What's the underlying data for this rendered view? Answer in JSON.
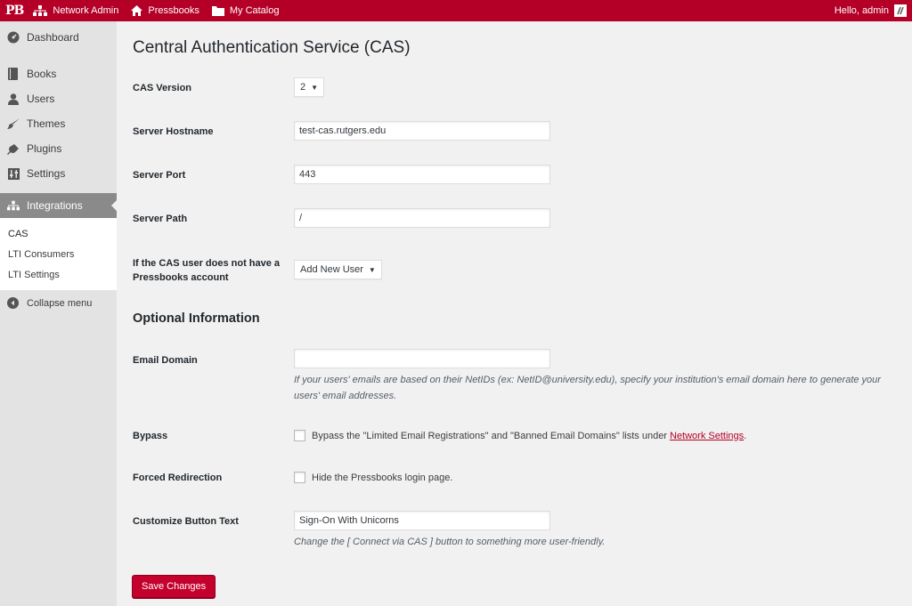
{
  "adminbar": {
    "logo": "PB",
    "network_admin": "Network Admin",
    "pressbooks": "Pressbooks",
    "my_catalog": "My Catalog",
    "greeting": "Hello, admin"
  },
  "sidebar": {
    "items": [
      {
        "label": "Dashboard",
        "icon": "dashboard-icon"
      },
      {
        "label": "Books",
        "icon": "book-icon"
      },
      {
        "label": "Users",
        "icon": "user-icon"
      },
      {
        "label": "Themes",
        "icon": "brush-icon"
      },
      {
        "label": "Plugins",
        "icon": "plug-icon"
      },
      {
        "label": "Settings",
        "icon": "settings-icon"
      },
      {
        "label": "Integrations",
        "icon": "network-icon"
      }
    ],
    "submenu": [
      "CAS",
      "LTI Consumers",
      "LTI Settings"
    ],
    "collapse": "Collapse menu"
  },
  "page": {
    "title": "Central Authentication Service (CAS)",
    "cas_version_label": "CAS Version",
    "cas_version_value": "2",
    "hostname_label": "Server Hostname",
    "hostname_value": "test-cas.rutgers.edu",
    "port_label": "Server Port",
    "port_value": "443",
    "path_label": "Server Path",
    "path_value": "/",
    "no_account_label_line1": "If the CAS user does not have a",
    "no_account_label_line2": "Pressbooks account",
    "no_account_value": "Add New User",
    "optional_heading": "Optional Information",
    "email_domain_label": "Email Domain",
    "email_domain_value": "",
    "email_domain_desc_line1": "If your users' emails are based on their NetIDs (ex: NetID@university.edu), specify your institution's email domain here to generate your",
    "email_domain_desc_line2": "users' email addresses.",
    "bypass_label": "Bypass",
    "bypass_text": "Bypass the \"Limited Email Registrations\" and \"Banned Email Domains\" lists under",
    "bypass_link": "Network Settings",
    "bypass_suffix": ".",
    "forced_label": "Forced Redirection",
    "forced_text": "Hide the Pressbooks login page.",
    "button_text_label": "Customize Button Text",
    "button_text_value": "Sign-On With Unicorns",
    "button_text_desc": "Change the [ Connect via CAS ] button to something more user-friendly.",
    "save_label": "Save Changes"
  },
  "colors": {
    "brand": "#b40026",
    "sidebar_bg": "#e3e3e3",
    "active_menu": "#8a8a8a"
  }
}
